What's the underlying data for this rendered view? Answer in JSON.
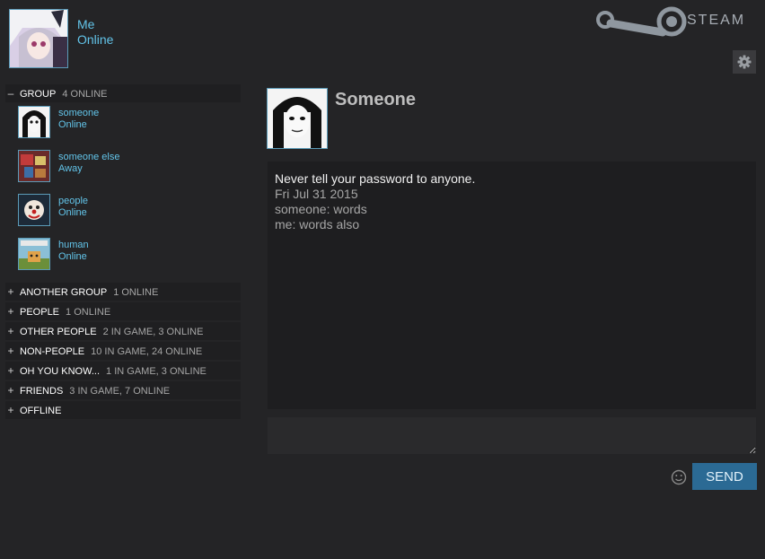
{
  "self": {
    "name": "Me",
    "status": "Online"
  },
  "brand": {
    "wordmark": "STEAM"
  },
  "open_group": {
    "toggle": "–",
    "name": "GROUP",
    "count": "4 ONLINE",
    "friends": [
      {
        "name": "someone",
        "status": "Online"
      },
      {
        "name": "someone else",
        "status": "Away"
      },
      {
        "name": "people",
        "status": "Online"
      },
      {
        "name": "human",
        "status": "Online"
      }
    ]
  },
  "collapsed_groups": [
    {
      "toggle": "+",
      "name": "ANOTHER GROUP",
      "count": "1 ONLINE"
    },
    {
      "toggle": "+",
      "name": "PEOPLE",
      "count": "1 ONLINE"
    },
    {
      "toggle": "+",
      "name": "OTHER PEOPLE",
      "count": "2 IN GAME, 3 ONLINE"
    },
    {
      "toggle": "+",
      "name": "NON-PEOPLE",
      "count": "10 IN GAME, 24 ONLINE"
    },
    {
      "toggle": "+",
      "name": "OH YOU KNOW...",
      "count": "1 IN GAME, 3 ONLINE"
    },
    {
      "toggle": "+",
      "name": "FRIENDS",
      "count": "3 IN GAME, 7 ONLINE"
    },
    {
      "toggle": "+",
      "name": "OFFLINE",
      "count": ""
    }
  ],
  "chat": {
    "partner_name": "Someone",
    "warning": "Never tell your password to anyone.",
    "date": "Fri Jul 31 2015",
    "messages": [
      {
        "text": "someone: words"
      },
      {
        "text": "me: words also"
      }
    ],
    "send_label": "SEND"
  },
  "colors": {
    "background": "#242426",
    "accent": "#62c3e8",
    "send_button": "#2b6a94"
  },
  "icons": {
    "settings": "gear-icon",
    "emoji": "smiley-icon",
    "logo": "steam-logo-icon"
  }
}
